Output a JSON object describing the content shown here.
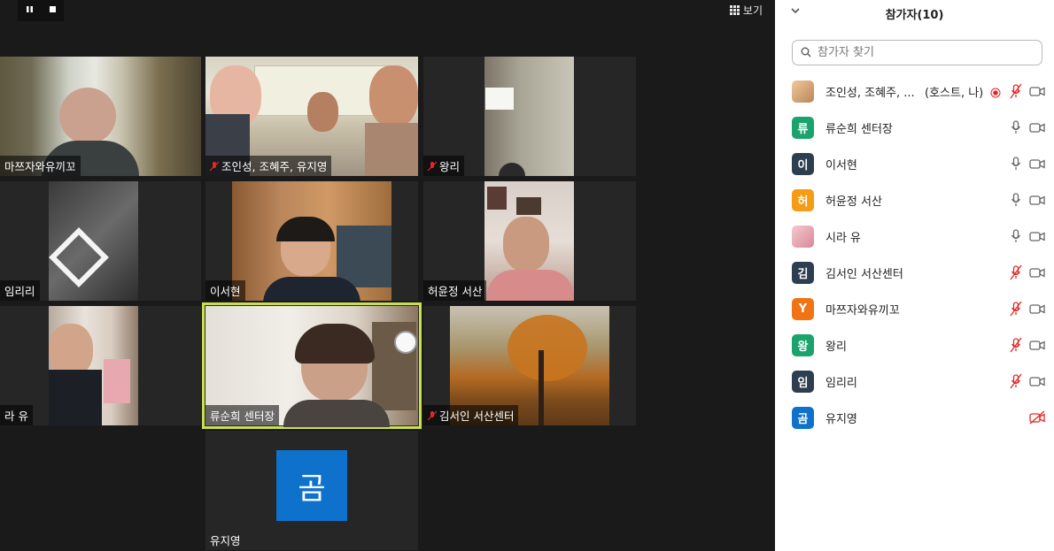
{
  "recording": {
    "pause_icon": "pause-icon",
    "stop_icon": "stop-icon"
  },
  "view_button": {
    "label": "보기",
    "icon": "grid-icon"
  },
  "tiles": [
    {
      "name": "마쯔자와유끼꼬",
      "muted": false,
      "active": false
    },
    {
      "name": "조인성, 조혜주, 유지영",
      "muted": true,
      "active": false
    },
    {
      "name": "왕리",
      "muted": true,
      "active": false
    },
    {
      "name": "임리리",
      "muted": true,
      "active": false
    },
    {
      "name": "이서현",
      "muted": false,
      "active": false
    },
    {
      "name": "허윤정 서산",
      "muted": false,
      "active": false
    },
    {
      "name": "라 유",
      "muted": false,
      "active": false
    },
    {
      "name": "류순희 센터장",
      "muted": false,
      "active": true
    },
    {
      "name": "김서인 서산센터",
      "muted": true,
      "active": false
    },
    {
      "name": "유지영",
      "muted": false,
      "active": false,
      "avatar_letter": "곰"
    }
  ],
  "panel": {
    "title": "참가자(10)",
    "search_placeholder": "참가자 찾기",
    "participants": [
      {
        "avatar": "photo",
        "avatar_color": "#d9a46a",
        "name": "조인성, 조혜주, ...",
        "extra": "(호스트, 나)",
        "recording": true,
        "mic": "muted",
        "cam": "on"
      },
      {
        "avatar": "류",
        "avatar_color": "#1aa36c",
        "name": "류순희 센터장",
        "extra": "",
        "mic": "on",
        "cam": "on"
      },
      {
        "avatar": "이",
        "avatar_color": "#2d3e50",
        "name": "이서현",
        "extra": "",
        "mic": "on",
        "cam": "on"
      },
      {
        "avatar": "허",
        "avatar_color": "#f59b14",
        "name": "허윤정 서산",
        "extra": "",
        "mic": "on",
        "cam": "on"
      },
      {
        "avatar": "photo",
        "avatar_color": "#e8a6b2",
        "name": "시라 유",
        "extra": "",
        "mic": "on",
        "cam": "on"
      },
      {
        "avatar": "김",
        "avatar_color": "#2d3e50",
        "name": "김서인 서산센터",
        "extra": "",
        "mic": "muted",
        "cam": "on"
      },
      {
        "avatar": "Y",
        "avatar_color": "#f07314",
        "name": "마쯔자와유끼꼬",
        "extra": "",
        "mic": "muted",
        "cam": "on"
      },
      {
        "avatar": "왕",
        "avatar_color": "#1aa36c",
        "name": "왕리",
        "extra": "",
        "mic": "muted",
        "cam": "on"
      },
      {
        "avatar": "임",
        "avatar_color": "#2d3e50",
        "name": "임리리",
        "extra": "",
        "mic": "muted",
        "cam": "on"
      },
      {
        "avatar": "곰",
        "avatar_color": "#0e72cc",
        "name": "유지영",
        "extra": "",
        "mic": "none",
        "cam": "off"
      }
    ]
  }
}
